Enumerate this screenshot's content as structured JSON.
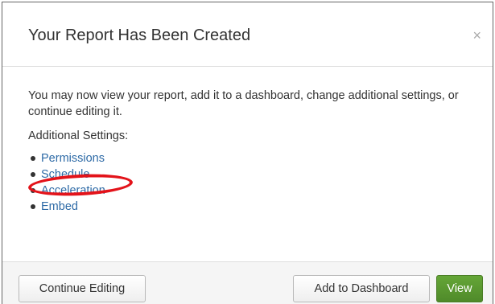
{
  "dialog": {
    "title": "Your Report Has Been Created",
    "close_icon": "×"
  },
  "body": {
    "intro": "You may now view your report, add it to a dashboard, change additional settings, or continue editing it.",
    "settings_label": "Additional Settings:",
    "links": [
      "Permissions",
      "Schedule",
      "Acceleration",
      "Embed"
    ],
    "highlighted_link": "Schedule",
    "highlight_color": "#e3131a"
  },
  "footer": {
    "continue_label": "Continue Editing",
    "dashboard_label": "Add to Dashboard",
    "view_label": "View"
  },
  "colors": {
    "link": "#2d6aa6",
    "primary_button": "#5a9a32"
  }
}
